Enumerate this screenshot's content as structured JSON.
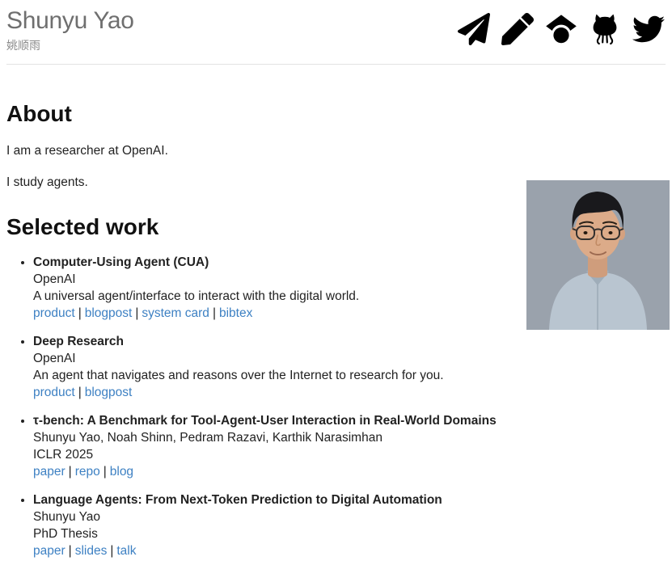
{
  "header": {
    "name": "Shunyu Yao",
    "chinese_name": "姚顺雨",
    "icons": [
      {
        "label": "email",
        "icon": "paper-plane-icon"
      },
      {
        "label": "blog",
        "icon": "pencil-icon"
      },
      {
        "label": "google-scholar",
        "icon": "graduation-cap-icon"
      },
      {
        "label": "github",
        "icon": "octocat-icon"
      },
      {
        "label": "twitter",
        "icon": "twitter-bird-icon"
      }
    ]
  },
  "about": {
    "heading": "About",
    "paragraphs": [
      "I am a researcher at OpenAI.",
      "I study agents."
    ]
  },
  "work": {
    "heading": "Selected work",
    "link_separator": "|",
    "items": [
      {
        "title": "Computer-Using Agent (CUA)",
        "byline": "OpenAI",
        "detail": "A universal agent/interface to interact with the digital world.",
        "links": [
          "product",
          "blogpost",
          "system card",
          "bibtex"
        ]
      },
      {
        "title": "Deep Research",
        "byline": "OpenAI",
        "detail": "An agent that navigates and reasons over the Internet to research for you.",
        "links": [
          "product",
          "blogpost"
        ]
      },
      {
        "title": "τ-bench: A Benchmark for Tool-Agent-User Interaction in Real-World Domains",
        "byline": "Shunyu Yao, Noah Shinn, Pedram Razavi, Karthik Narasimhan",
        "detail": "ICLR 2025",
        "links": [
          "paper",
          "repo",
          "blog"
        ]
      },
      {
        "title": "Language Agents: From Next-Token Prediction to Digital Automation",
        "byline": "Shunyu Yao",
        "detail": "PhD Thesis",
        "links": [
          "paper",
          "slides",
          "talk"
        ]
      }
    ]
  },
  "photo": {
    "description": "portrait photo, man with glasses, gray background, light blue shirt"
  },
  "colors": {
    "link_blue": "#3e81c3",
    "icon_black": "#000000",
    "name_gray": "#6f6f6f",
    "divider_gray": "#e3e3e3",
    "photo_background": "#9aa2ac"
  }
}
